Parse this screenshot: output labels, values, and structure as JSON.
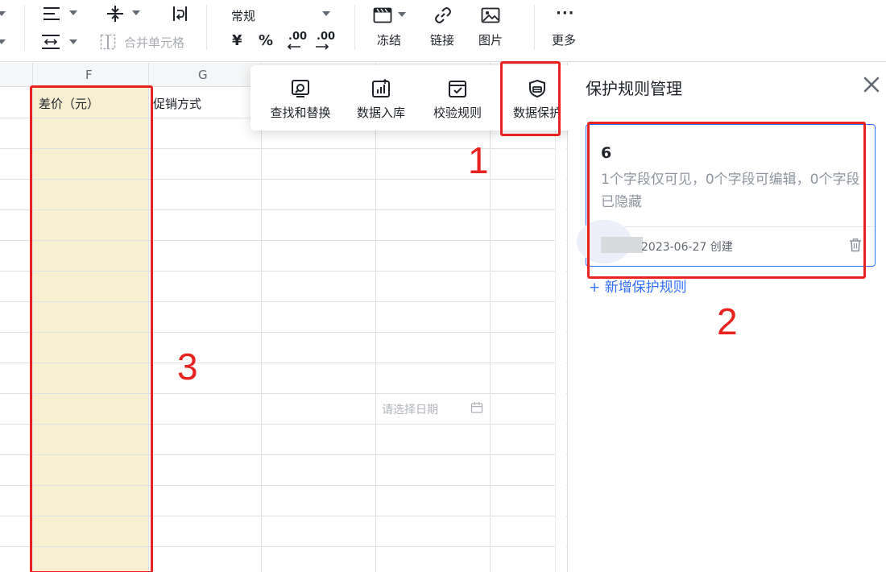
{
  "toolbar": {
    "number_format": "常规",
    "merge_cells_label": "合并单元格",
    "currency_symbol": "¥",
    "percent_symbol": "%",
    "decimal_decrease": ".00",
    "decimal_increase": ".00",
    "freeze_label": "冻结",
    "link_label": "链接",
    "image_label": "图片",
    "more_label": "更多",
    "more_symbol": "···"
  },
  "sheet": {
    "columns": [
      "F",
      "G"
    ],
    "cells": {
      "f1": "差价（元）",
      "g1": "促销方式"
    },
    "date_placeholder": "请选择日期",
    "highlight_color": "#f8efd3"
  },
  "menu": {
    "items": [
      {
        "label": "查找和替换",
        "icon": "find-replace-icon"
      },
      {
        "label": "数据入库",
        "icon": "data-import-icon"
      },
      {
        "label": "校验规则",
        "icon": "validation-icon"
      },
      {
        "label": "数据保护",
        "icon": "shield-lock-icon"
      }
    ]
  },
  "panel": {
    "title": "保护规则管理",
    "rule": {
      "name": "6",
      "description": "1个字段仅可见，0个字段可编辑，0个字段已隐藏",
      "footer": "2023-06-27 创建"
    },
    "add_rule": "+ 新增保护规则",
    "accent_color": "#3370ff"
  },
  "annotations": {
    "color": "#e8231f",
    "labels": [
      "1",
      "2",
      "3"
    ]
  }
}
